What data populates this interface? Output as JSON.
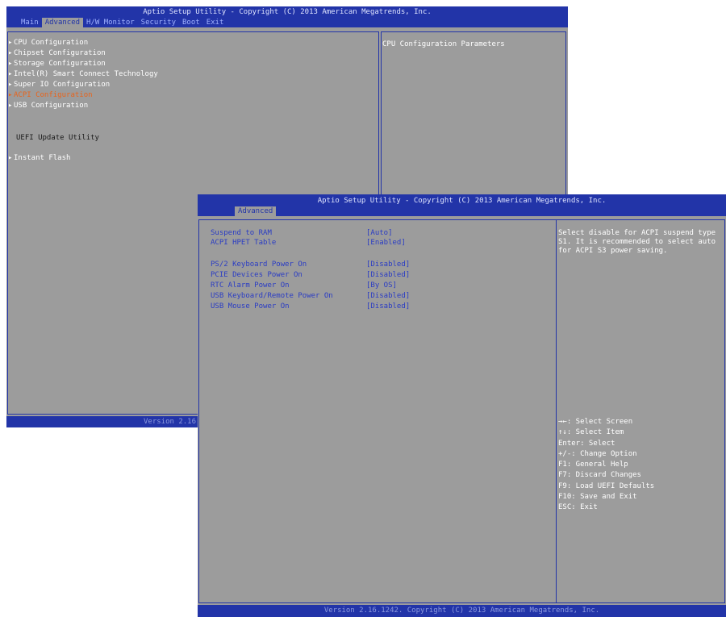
{
  "back": {
    "title": "Aptio Setup Utility - Copyright (C) 2013 American Megatrends, Inc.",
    "tabs": [
      "Main",
      "Advanced",
      "H/W Monitor",
      "Security",
      "Boot",
      "Exit"
    ],
    "active_tab": "Advanced",
    "menu_items": [
      "CPU Configuration",
      "Chipset Configuration",
      "Storage Configuration",
      "Intel(R) Smart Connect Technology",
      "Super IO Configuration",
      "ACPI Configuration",
      "USB Configuration"
    ],
    "section_label": "UEFI Update Utility",
    "instant_flash": "Instant Flash",
    "help_text": "CPU Configuration Parameters",
    "status": "Version 2.16"
  },
  "front": {
    "title": "Aptio Setup Utility - Copyright (C) 2013 American Megatrends, Inc.",
    "tab": "Advanced",
    "settings": [
      {
        "label": "Suspend to RAM",
        "value": "[Auto]"
      },
      {
        "label": "ACPI HPET Table",
        "value": "[Enabled]"
      },
      {
        "label": "PS/2 Keyboard Power On",
        "value": "[Disabled]"
      },
      {
        "label": "PCIE Devices Power On",
        "value": "[Disabled]"
      },
      {
        "label": "RTC Alarm Power On",
        "value": "[By OS]"
      },
      {
        "label": "USB Keyboard/Remote Power On",
        "value": "[Disabled]"
      },
      {
        "label": "USB Mouse Power On",
        "value": "[Disabled]"
      }
    ],
    "help_text": "Select disable for ACPI suspend type S1. It is recommended to select auto for ACPI S3 power saving.",
    "key_help": [
      "→←: Select Screen",
      "↑↓: Select Item",
      "Enter: Select",
      "+/-: Change Option",
      "F1: General Help",
      "F7: Discard Changes",
      "F9: Load UEFI Defaults",
      "F10: Save and Exit",
      "ESC: Exit"
    ],
    "status": "Version 2.16.1242. Copyright (C) 2013 American Megatrends, Inc."
  },
  "colors": {
    "bios_blue": "#2234a8",
    "bios_gray": "#9c9c9c",
    "highlight_orange": "#e8641c"
  }
}
